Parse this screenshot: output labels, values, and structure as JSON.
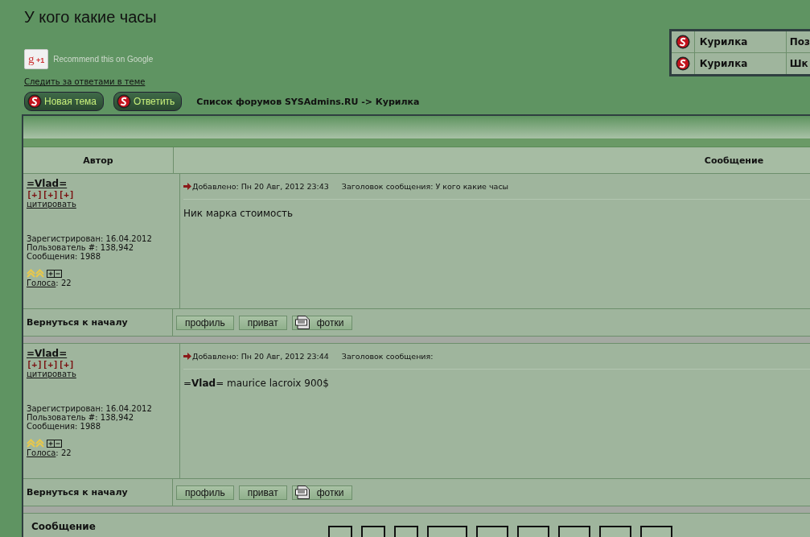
{
  "page_title": "У кого какие часы",
  "google_plus": {
    "logo": "g",
    "count": "+1",
    "label": "Recommend this on Google"
  },
  "watch_link": "Следить за ответами в теме",
  "action_buttons": [
    "Новая тема",
    "Ответить"
  ],
  "breadcrumb": "Список форумов SYSAdmins.RU -> Курилка",
  "recent_topics": [
    {
      "forum": "Курилка",
      "column_3": "Поз"
    },
    {
      "forum": "Курилка",
      "column_3": "Шк"
    }
  ],
  "table": {
    "columns": [
      "Автор",
      "Сообщение"
    ]
  },
  "posts": [
    {
      "author": "=Vlad=",
      "ranks": "[+][+][+]",
      "quote": "цитировать",
      "registered": "Зарегистрирован: 16.04.2012",
      "user_no": "Пользователь #: 138,942",
      "messages": "Сообщения: 1988",
      "votes_label": "Голоса",
      "votes": ": 22",
      "posted": "Добавлено: Пн 20 Авг, 2012 23:43",
      "subject": "Заголовок сообщения: У кого какие часы",
      "body": "Ник марка стоимость",
      "back": "Вернуться к началу",
      "buttons": [
        {
          "kind": "plain",
          "label": "профиль"
        },
        {
          "kind": "plain",
          "label": "приват"
        },
        {
          "kind": "photo",
          "label": "фотки"
        }
      ]
    },
    {
      "author": "=Vlad=",
      "ranks": "[+][+][+]",
      "quote": "цитировать",
      "registered": "Зарегистрирован: 16.04.2012",
      "user_no": "Пользователь #: 138,942",
      "messages": "Сообщения: 1988",
      "votes_label": "Голоса",
      "votes": ": 22",
      "posted": "Добавлено: Пн 20 Авг, 2012 23:44",
      "subject": "Заголовок сообщения:",
      "body": "=**Vlad**= maurice lacroix 900$",
      "back": "Вернуться к началу",
      "buttons": [
        {
          "kind": "plain",
          "label": "профиль"
        },
        {
          "kind": "plain",
          "label": "приват"
        },
        {
          "kind": "photo",
          "label": "фотки"
        }
      ]
    }
  ],
  "reply": {
    "label": "Сообщение"
  }
}
